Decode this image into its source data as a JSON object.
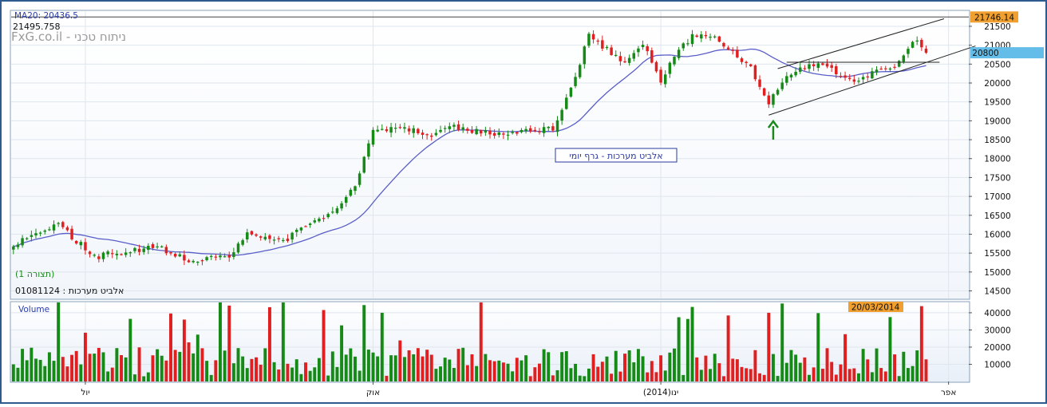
{
  "chart_data": {
    "type": "candlestick",
    "header": {
      "ma_label": "MA20: 20436.5",
      "price_readout": "21495.758",
      "watermark": "FxG.co.il - ניתוח טכני"
    },
    "annotation_box": "אלביט מערכות - גרף יומי",
    "figure_label": "(תצורה 1)",
    "symbol_label": "אלביט מערכות : 01081124",
    "volume_label": "Volume",
    "date_badge": "20/03/2014",
    "price_axis": {
      "ticks": [
        14500,
        15000,
        15500,
        16000,
        16500,
        17000,
        17500,
        18000,
        18500,
        19000,
        19500,
        20000,
        20500,
        21000,
        21500
      ],
      "ylim": [
        14300,
        21900
      ],
      "top_line_value": 21746.14,
      "top_line_label": "21746.14",
      "current_value": 20800,
      "current_label": "20800"
    },
    "volume_axis": {
      "ticks": [
        10000,
        20000,
        30000,
        40000
      ],
      "tick_labels": [
        "10000",
        "20000",
        "30000",
        "40000"
      ],
      "ylim": [
        0,
        46000
      ]
    },
    "x_axis": {
      "labels": [
        {
          "text": "יול",
          "index": 16
        },
        {
          "text": "אוק",
          "index": 80
        },
        {
          "text": "ינו(2014)",
          "index": 144
        },
        {
          "text": "אפר",
          "index": 208
        }
      ],
      "n_slots": 213
    },
    "key_closes": [
      [
        0,
        15750
      ],
      [
        10,
        16250
      ],
      [
        18,
        15400
      ],
      [
        25,
        15550
      ],
      [
        32,
        15650
      ],
      [
        40,
        15250
      ],
      [
        48,
        15450
      ],
      [
        52,
        16050
      ],
      [
        60,
        15800
      ],
      [
        66,
        16300
      ],
      [
        72,
        16650
      ],
      [
        76,
        17300
      ],
      [
        80,
        18750
      ],
      [
        86,
        18850
      ],
      [
        92,
        18600
      ],
      [
        98,
        18850
      ],
      [
        104,
        18700
      ],
      [
        110,
        18650
      ],
      [
        116,
        18800
      ],
      [
        120,
        18750
      ],
      [
        124,
        19800
      ],
      [
        128,
        21250
      ],
      [
        132,
        20900
      ],
      [
        136,
        20500
      ],
      [
        140,
        21050
      ],
      [
        144,
        20050
      ],
      [
        148,
        20950
      ],
      [
        152,
        21300
      ],
      [
        156,
        21200
      ],
      [
        160,
        20850
      ],
      [
        164,
        20400
      ],
      [
        168,
        19500
      ],
      [
        172,
        20150
      ],
      [
        176,
        20400
      ],
      [
        180,
        20550
      ],
      [
        184,
        20200
      ],
      [
        188,
        20050
      ],
      [
        192,
        20350
      ],
      [
        196,
        20450
      ],
      [
        198,
        20800
      ],
      [
        201,
        21200
      ],
      [
        203,
        20800
      ]
    ],
    "sma_period": 20,
    "arrow_index": 169,
    "arrow_color": "#1a8a1a",
    "channel": {
      "lower": [
        [
          168,
          19150
        ],
        [
          214,
          20980
        ]
      ],
      "upper": [
        [
          170,
          20380
        ],
        [
          207,
          21700
        ]
      ],
      "horizontal": [
        [
          172,
          20550
        ],
        [
          206,
          20550
        ]
      ]
    },
    "colors": {
      "up": "#168a16",
      "down": "#e02020",
      "ma": "#5a5ec8",
      "accent_orange": "#f0a030",
      "current_badge": "#64bde8",
      "border": "#2f5a8f"
    }
  }
}
